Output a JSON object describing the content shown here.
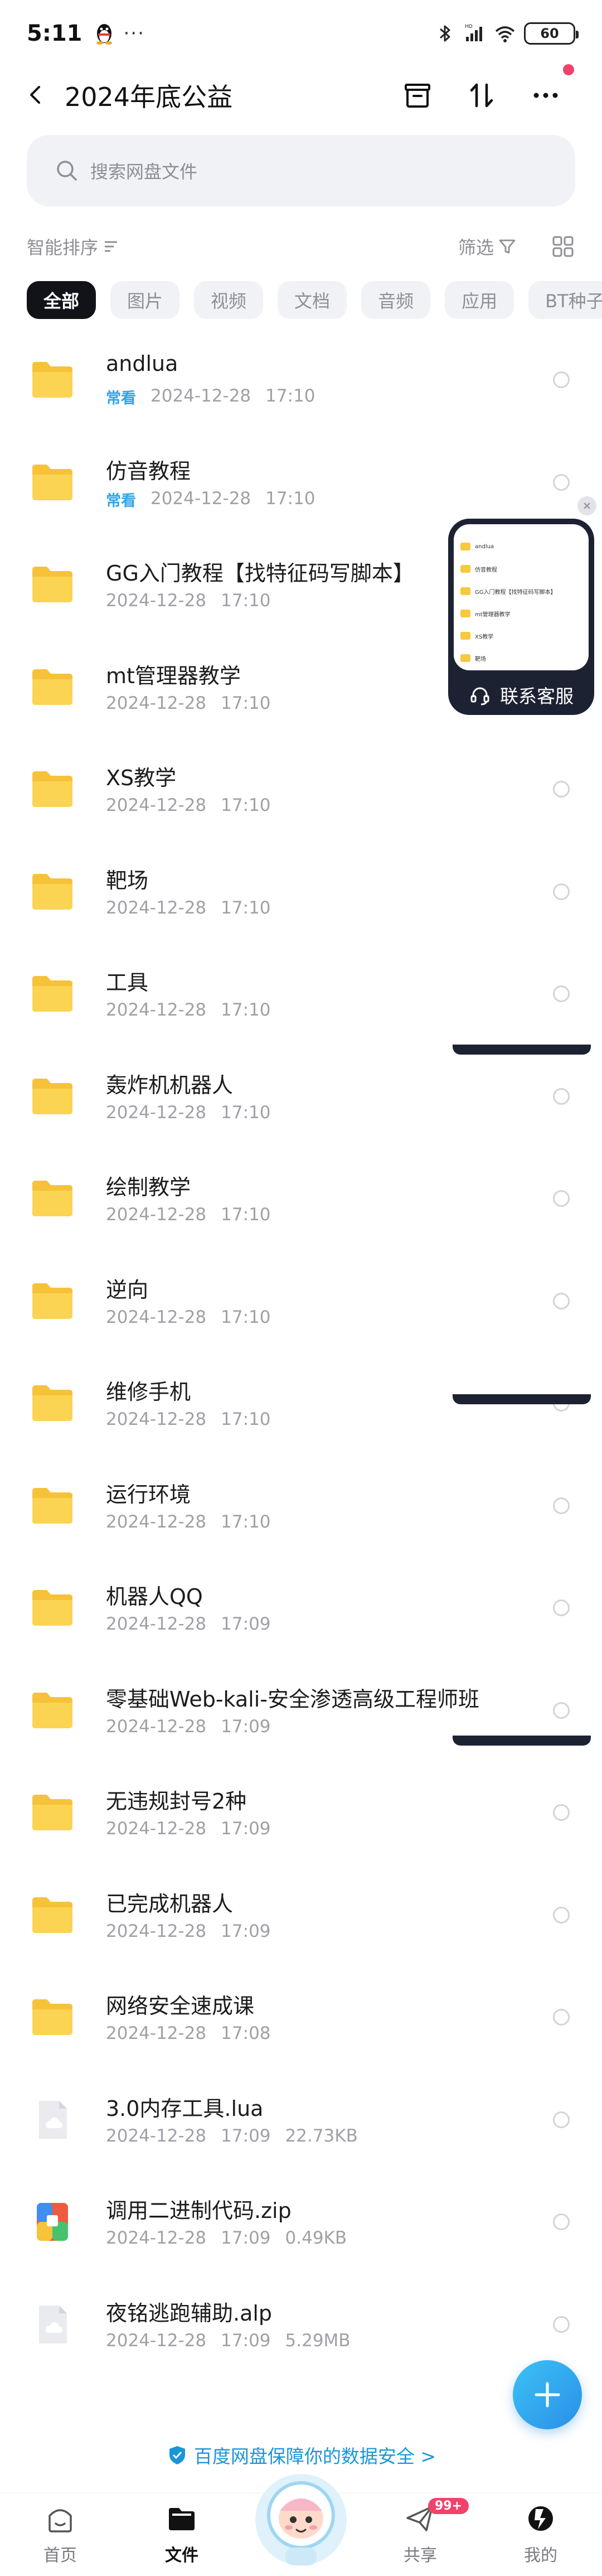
{
  "status_bar": {
    "time": "5:11",
    "more": "···",
    "battery": "60"
  },
  "header": {
    "title": "2024年底公益"
  },
  "search": {
    "placeholder": "搜索网盘文件"
  },
  "sort": {
    "label": "智能排序",
    "filter_label": "筛选"
  },
  "chips": [
    "全部",
    "图片",
    "视频",
    "文档",
    "音频",
    "应用",
    "BT种子"
  ],
  "files": [
    {
      "name": "andlua",
      "tag": "常看",
      "date": "2024-12-28",
      "time": "17:10",
      "size": "",
      "type": "folder"
    },
    {
      "name": "仿音教程",
      "tag": "常看",
      "date": "2024-12-28",
      "time": "17:10",
      "size": "",
      "type": "folder"
    },
    {
      "name": "GG入门教程【找特征码写脚本】",
      "tag": "",
      "date": "2024-12-28",
      "time": "17:10",
      "size": "",
      "type": "folder"
    },
    {
      "name": "mt管理器教学",
      "tag": "",
      "date": "2024-12-28",
      "time": "17:10",
      "size": "",
      "type": "folder"
    },
    {
      "name": "XS教学",
      "tag": "",
      "date": "2024-12-28",
      "time": "17:10",
      "size": "",
      "type": "folder"
    },
    {
      "name": "靶场",
      "tag": "",
      "date": "2024-12-28",
      "time": "17:10",
      "size": "",
      "type": "folder"
    },
    {
      "name": "工具",
      "tag": "",
      "date": "2024-12-28",
      "time": "17:10",
      "size": "",
      "type": "folder"
    },
    {
      "name": "轰炸机机器人",
      "tag": "",
      "date": "2024-12-28",
      "time": "17:10",
      "size": "",
      "type": "folder"
    },
    {
      "name": "绘制教学",
      "tag": "",
      "date": "2024-12-28",
      "time": "17:10",
      "size": "",
      "type": "folder"
    },
    {
      "name": "逆向",
      "tag": "",
      "date": "2024-12-28",
      "time": "17:10",
      "size": "",
      "type": "folder"
    },
    {
      "name": "维修手机",
      "tag": "",
      "date": "2024-12-28",
      "time": "17:10",
      "size": "",
      "type": "folder"
    },
    {
      "name": "运行环境",
      "tag": "",
      "date": "2024-12-28",
      "time": "17:10",
      "size": "",
      "type": "folder"
    },
    {
      "name": "机器人QQ",
      "tag": "",
      "date": "2024-12-28",
      "time": "17:09",
      "size": "",
      "type": "folder"
    },
    {
      "name": "零基础Web-kali-安全渗透高级工程师班",
      "tag": "",
      "date": "2024-12-28",
      "time": "17:09",
      "size": "",
      "type": "folder"
    },
    {
      "name": "无违规封号2种",
      "tag": "",
      "date": "2024-12-28",
      "time": "17:09",
      "size": "",
      "type": "folder"
    },
    {
      "name": "已完成机器人",
      "tag": "",
      "date": "2024-12-28",
      "time": "17:09",
      "size": "",
      "type": "folder"
    },
    {
      "name": "网络安全速成课",
      "tag": "",
      "date": "2024-12-28",
      "time": "17:08",
      "size": "",
      "type": "folder"
    },
    {
      "name": "3.0内存工具.lua",
      "tag": "",
      "date": "2024-12-28",
      "time": "17:09",
      "size": "22.73KB",
      "type": "file"
    },
    {
      "name": "调用二进制代码.zip",
      "tag": "",
      "date": "2024-12-28",
      "time": "17:09",
      "size": "0.49KB",
      "type": "zip"
    },
    {
      "name": "夜铭逃跑辅助.alp",
      "tag": "",
      "date": "2024-12-28",
      "time": "17:09",
      "size": "5.29MB",
      "type": "file"
    }
  ],
  "service_widget": {
    "label": "联系客服",
    "preview_items": [
      "andlua",
      "仿音教程",
      "GG入门教程【找特征码写脚本】",
      "mt管理器教学",
      "XS教学",
      "靶场"
    ]
  },
  "security_banner": "百度网盘保障你的数据安全 >",
  "bottom_nav": {
    "home": "首页",
    "files": "文件",
    "share": "共享",
    "share_badge": "99+",
    "me": "我的"
  },
  "colors": {
    "accent": "#2fa4e7",
    "folder": "#f7c93e",
    "dark": "#111319",
    "badge": "#f0426b"
  }
}
